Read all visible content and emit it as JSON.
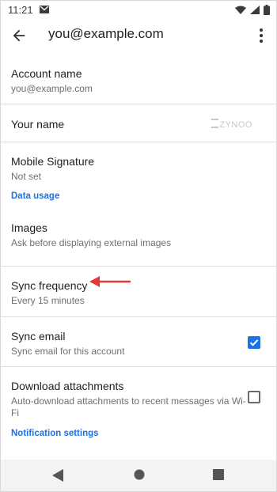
{
  "status_bar": {
    "time": "11:21"
  },
  "app_bar": {
    "title": "you@example.com"
  },
  "settings": {
    "account_name": {
      "label": "Account name",
      "value": "you@example.com"
    },
    "your_name": {
      "label": "Your name",
      "watermark": "ZYNOO"
    },
    "mobile_signature": {
      "label": "Mobile Signature",
      "value": "Not set"
    },
    "data_usage_header": "Data usage",
    "images": {
      "label": "Images",
      "value": "Ask before displaying external images"
    },
    "sync_frequency": {
      "label": "Sync frequency",
      "value": "Every 15 minutes"
    },
    "sync_email": {
      "label": "Sync email",
      "value": "Sync email for this account",
      "checked": true
    },
    "download_attachments": {
      "label": "Download attachments",
      "value": "Auto-download attachments to recent messages via Wi-Fi",
      "checked": false
    },
    "notification_header": "Notification settings"
  },
  "colors": {
    "accent": "#1a73e8",
    "annotation_arrow": "#e53935"
  },
  "icons": [
    "back-arrow-icon",
    "more-vert-icon",
    "wifi-icon",
    "signal-icon",
    "battery-icon",
    "mail-icon",
    "check-icon"
  ]
}
